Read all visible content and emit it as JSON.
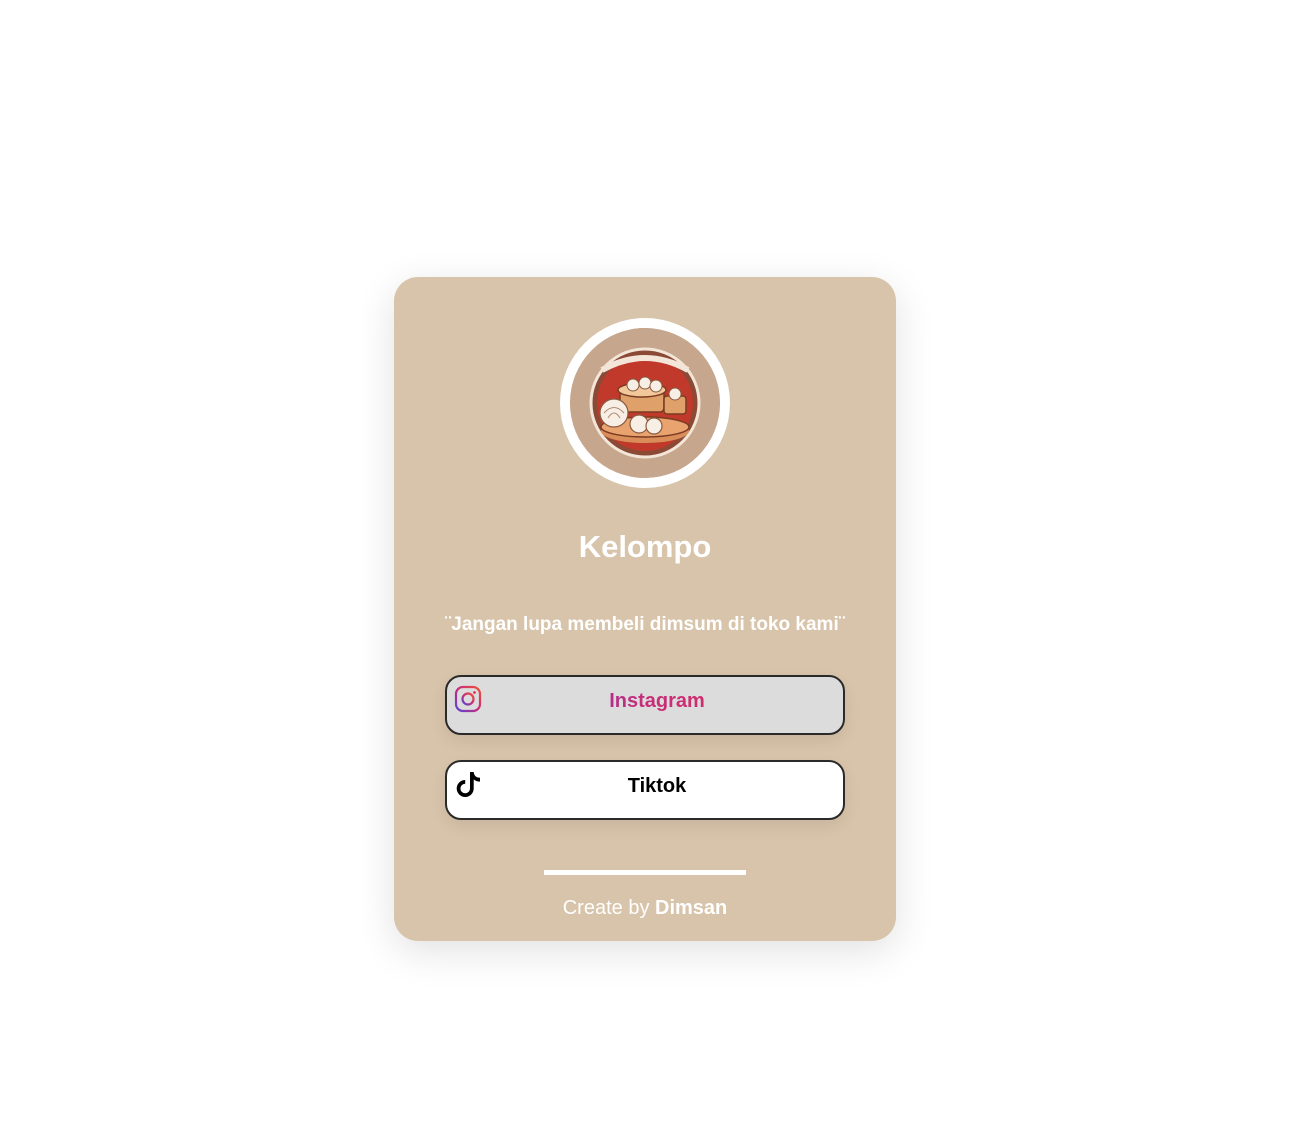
{
  "profile": {
    "name": "Kelompo",
    "tagline": "¨Jangan lupa membeli dimsum di toko kami¨",
    "avatar_icon": "dimsum-logo"
  },
  "links": [
    {
      "label": "Instagram",
      "icon": "instagram-icon"
    },
    {
      "label": "Tiktok",
      "icon": "tiktok-icon"
    }
  ],
  "footer": {
    "prefix": "Create by",
    "author": "Dimsan"
  },
  "colors": {
    "card_background": "#d8c4aa",
    "instagram_button": "#dcdcdc",
    "tiktok_button": "#ffffff",
    "text": "#ffffff"
  }
}
